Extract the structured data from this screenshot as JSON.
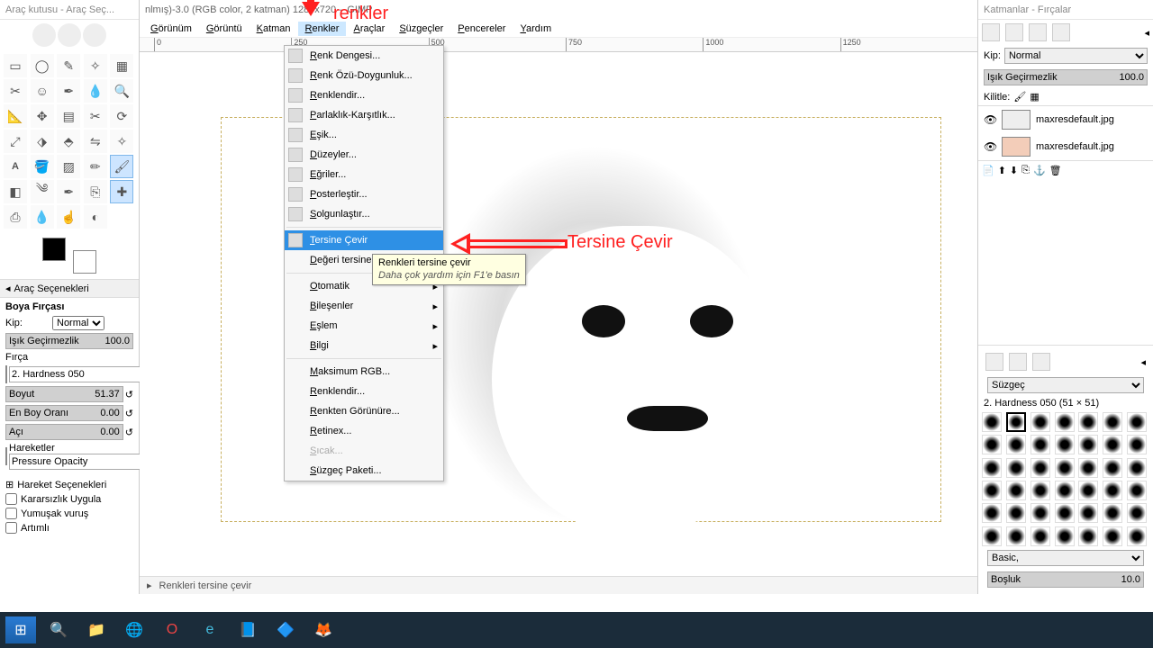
{
  "toolbox": {
    "title": "Araç kutusu - Araç Seç...",
    "options_title": "Araç Seçenekleri",
    "brush_title": "Boya Fırçası",
    "mode_label": "Kip:",
    "mode_value": "Normal",
    "opacity_label": "Işık Geçirmezlik",
    "opacity_value": "100.0",
    "brush_label": "Fırça",
    "brush_name": "2. Hardness 050",
    "size_label": "Boyut",
    "size_value": "51.37",
    "aspect_label": "En Boy Oranı",
    "aspect_value": "0.00",
    "angle_label": "Açı",
    "angle_value": "0.00",
    "dynamics_label": "Hareketler",
    "dynamics_value": "Pressure Opacity",
    "dyn_opts": "Hareket Seçenekleri",
    "chk_jitter": "Kararsızlık Uygula",
    "chk_smooth": "Yumuşak vuruş",
    "chk_incremental": "Artımlı"
  },
  "document": {
    "title": "nlmış)-3.0 (RGB color, 2 katman) 1280x720 – GIMP",
    "status": "Renkleri tersine çevir",
    "ruler_marks": [
      "0",
      "250",
      "500",
      "750",
      "1000",
      "1250"
    ]
  },
  "menubar": {
    "items": [
      "Görünüm",
      "Görüntü",
      "Katman",
      "Renkler",
      "Araçlar",
      "Süzgeçler",
      "Pencereler",
      "Yardım"
    ],
    "active_index": 3
  },
  "menu": {
    "items": [
      {
        "label": "Renk Dengesi...",
        "icon": true
      },
      {
        "label": "Renk Özü-Doygunluk...",
        "icon": true
      },
      {
        "label": "Renklendir...",
        "icon": true
      },
      {
        "label": "Parlaklık-Karşıtlık...",
        "icon": true
      },
      {
        "label": "Eşik...",
        "icon": true
      },
      {
        "label": "Düzeyler...",
        "icon": true
      },
      {
        "label": "Eğriler...",
        "icon": true
      },
      {
        "label": "Posterleştir...",
        "icon": true
      },
      {
        "label": "Solgunlaştır...",
        "icon": true
      },
      {
        "sep": true
      },
      {
        "label": "Tersine Çevir",
        "icon": true,
        "highlight": true
      },
      {
        "label": "Değeri tersine",
        "icon": false
      },
      {
        "sep": true
      },
      {
        "label": "Otomatik",
        "sub": true
      },
      {
        "label": "Bileşenler",
        "sub": true
      },
      {
        "label": "Eşlem",
        "sub": true
      },
      {
        "label": "Bilgi",
        "sub": true
      },
      {
        "sep": true
      },
      {
        "label": "Maksimum RGB..."
      },
      {
        "label": "Renklendir..."
      },
      {
        "label": "Renkten Görünüre..."
      },
      {
        "label": "Retinex..."
      },
      {
        "label": "Sıcak...",
        "disabled": true
      },
      {
        "label": "Süzgeç Paketi..."
      }
    ]
  },
  "tooltip": {
    "title": "Renkleri tersine çevir",
    "hint": "Daha çok yardım için F1'e basın"
  },
  "annotations": {
    "top_label": "renkler",
    "side_label": "Tersine Çevir"
  },
  "layers": {
    "title": "Katmanlar - Fırçalar",
    "mode_label": "Kip:",
    "mode_value": "Normal",
    "opacity_label": "Işık Geçirmezlik",
    "opacity_value": "100.0",
    "lock_label": "Kilitle:",
    "layer_names": [
      "maxresdefault.jpg",
      "maxresdefault.jpg"
    ],
    "brush_filter": "Süzgeç",
    "brush_info": "2. Hardness 050 (51 × 51)",
    "brush_preset_set": "Basic,",
    "spacing_label": "Boşluk",
    "spacing_value": "10.0"
  }
}
